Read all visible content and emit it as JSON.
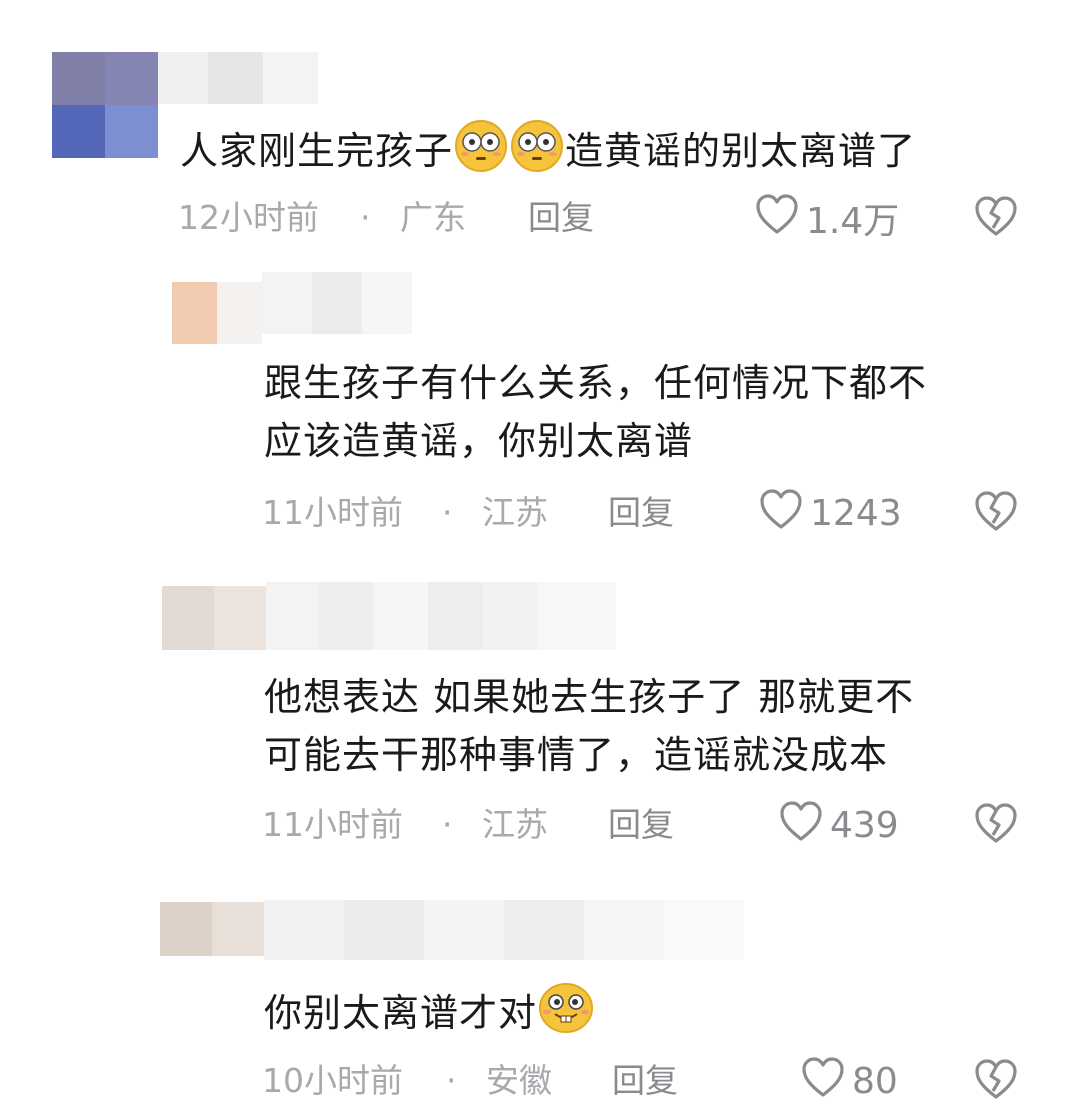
{
  "comments": [
    {
      "text_before": "人家刚生完孩子",
      "text_after": "造黄谣的别太离谱了",
      "emoji": "flushed-emoji",
      "time": "12小时前",
      "dot": "·",
      "location": "广东",
      "reply": "回复",
      "likes": "1.4万"
    },
    {
      "line1": "跟生孩子有什么关系，任何情况下都不",
      "line2": "应该造黄谣，你别太离谱",
      "time": "11小时前",
      "dot": "·",
      "location": "江苏",
      "reply": "回复",
      "likes": "1243"
    },
    {
      "line1": "他想表达 如果她去生孩子了 那就更不",
      "line2": "可能去干那种事情了，造谣就没成本",
      "time": "11小时前",
      "dot": "·",
      "location": "江苏",
      "reply": "回复",
      "likes": "439"
    },
    {
      "text": "你别太离谱才对",
      "emoji": "buck-tooth-emoji",
      "time": "10小时前",
      "dot": "·",
      "location": "安徽",
      "reply": "回复",
      "likes": "80"
    }
  ],
  "icons": {
    "like": "heart-outline-icon",
    "dislike": "broken-heart-icon"
  },
  "colors": {
    "meta": "#a8a8ad",
    "text": "#1a1a1a",
    "emoji": "#f6c43c"
  }
}
